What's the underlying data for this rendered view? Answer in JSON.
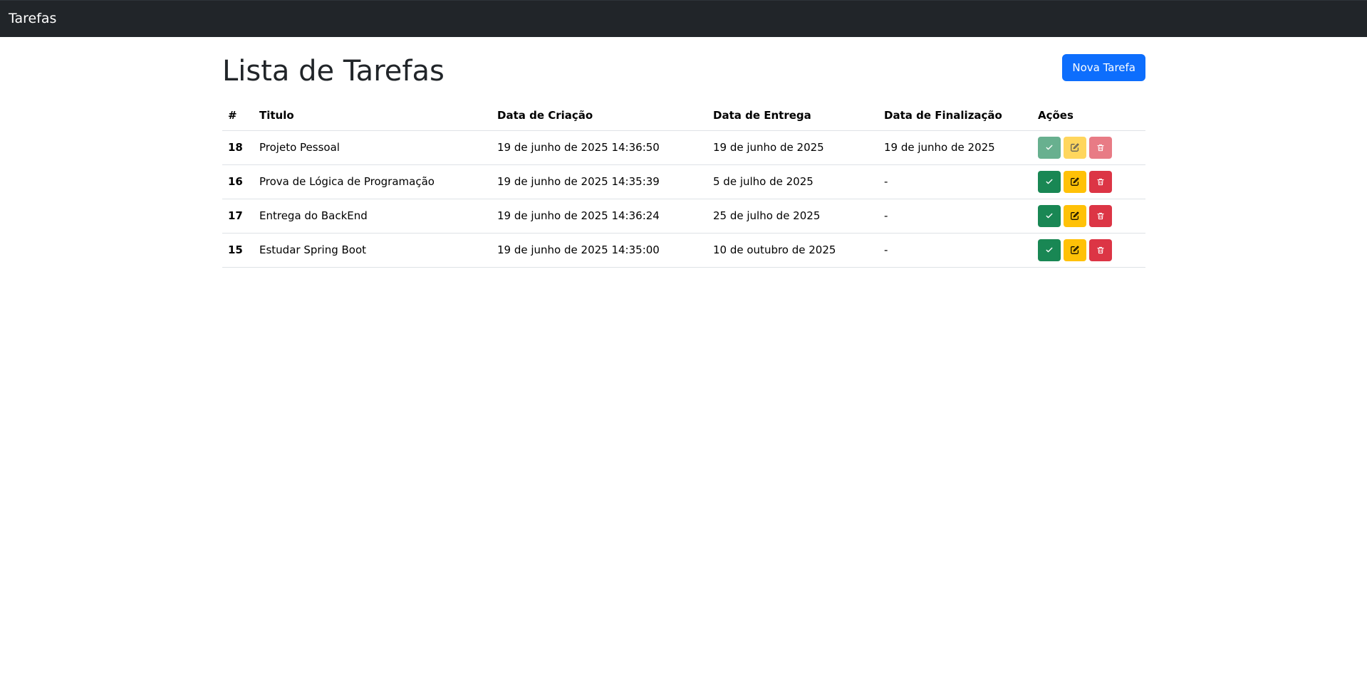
{
  "navbar": {
    "brand": "Tarefas"
  },
  "page": {
    "title": "Lista de Tarefas",
    "new_button": "Nova Tarefa"
  },
  "table": {
    "headers": [
      "#",
      "Titulo",
      "Data de Criação",
      "Data de Entrega",
      "Data de Finalização",
      "Ações"
    ],
    "rows": [
      {
        "id": "18",
        "title": "Projeto Pessoal",
        "created": "19 de junho de 2025 14:36:50",
        "due": "19 de junho de 2025",
        "finished": "19 de junho de 2025",
        "done_disabled": true
      },
      {
        "id": "16",
        "title": "Prova de Lógica de Programação",
        "created": "19 de junho de 2025 14:35:39",
        "due": "5 de julho de 2025",
        "finished": "-",
        "done_disabled": false
      },
      {
        "id": "17",
        "title": "Entrega do BackEnd",
        "created": "19 de junho de 2025 14:36:24",
        "due": "25 de julho de 2025",
        "finished": "-",
        "done_disabled": false
      },
      {
        "id": "15",
        "title": "Estudar Spring Boot",
        "created": "19 de junho de 2025 14:35:00",
        "due": "10 de outubro de 2025",
        "finished": "-",
        "done_disabled": false
      }
    ]
  },
  "icons": {
    "done": "check-icon",
    "edit": "pencil-square-icon",
    "delete": "trash-icon"
  },
  "colors": {
    "navbar": "#212529",
    "primary": "#0d6efd",
    "success": "#198754",
    "warning": "#ffc107",
    "danger": "#dc3545"
  }
}
